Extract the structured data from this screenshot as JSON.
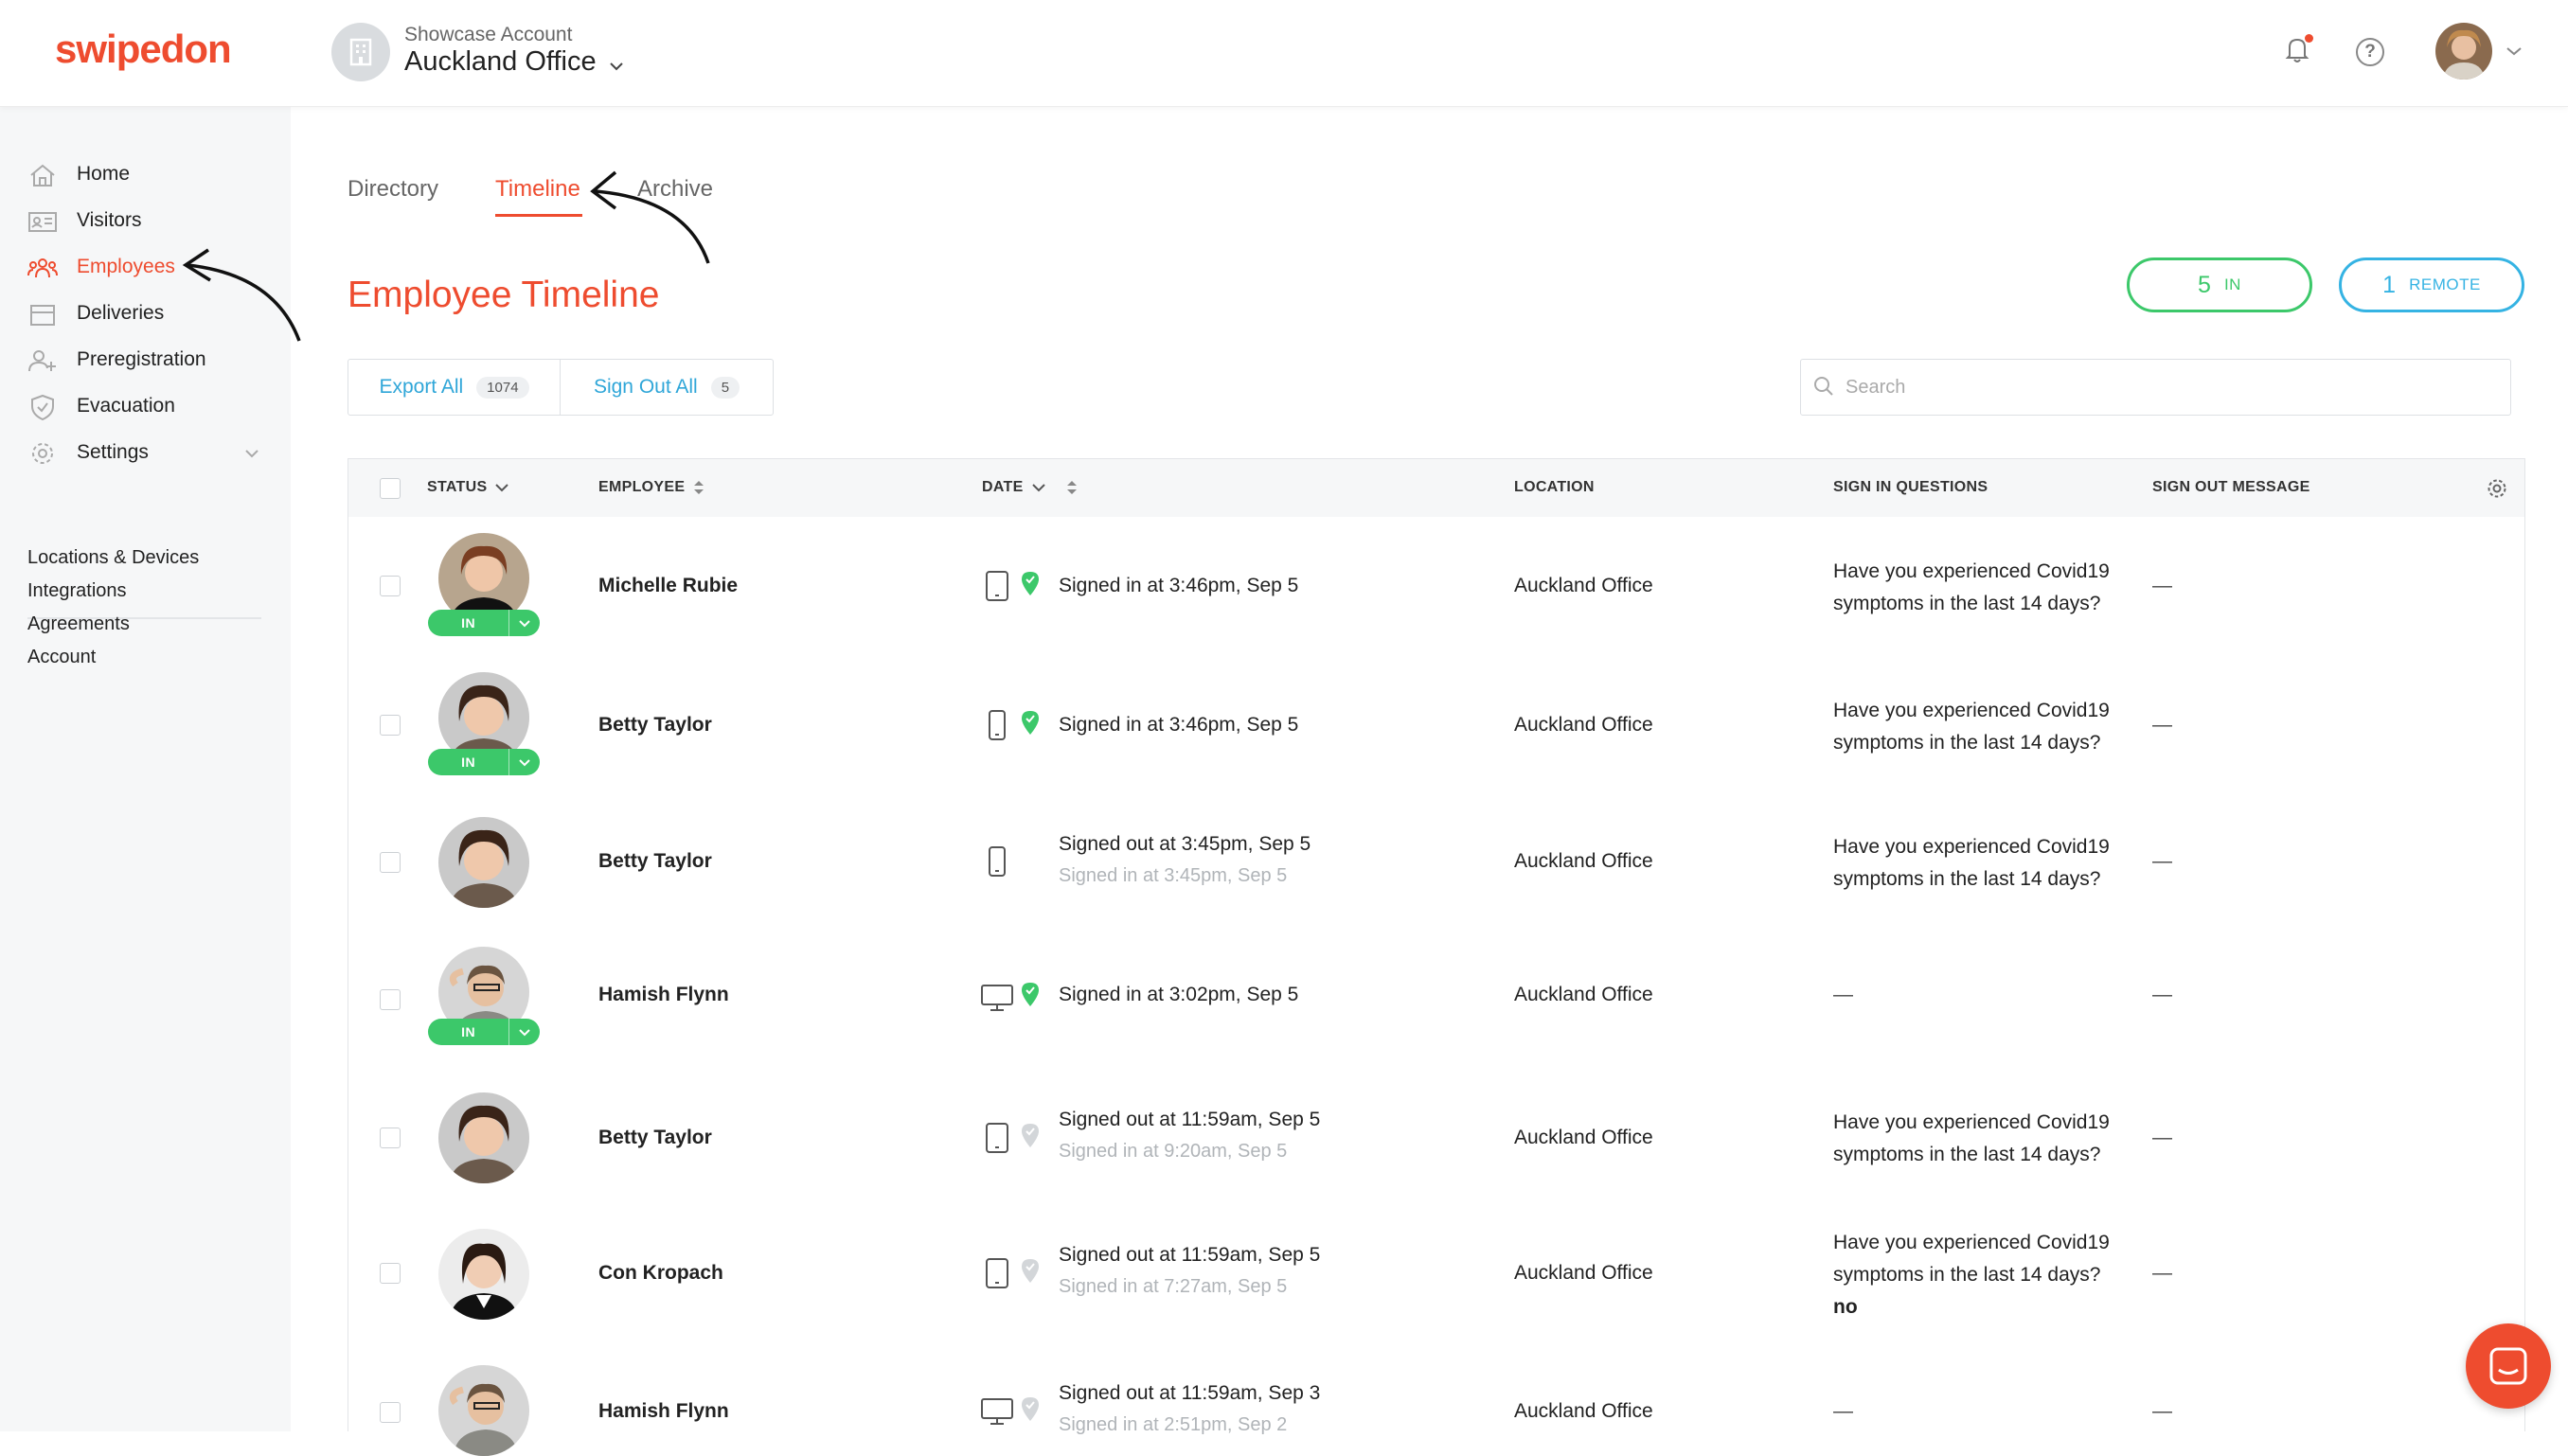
{
  "header": {
    "logo": "swipedon",
    "account_sub": "Showcase Account",
    "account_name": "Auckland Office"
  },
  "sidebar": {
    "items": [
      {
        "label": "Home",
        "icon": "home-icon"
      },
      {
        "label": "Visitors",
        "icon": "visitor-card-icon"
      },
      {
        "label": "Employees",
        "icon": "employees-icon",
        "active": true
      },
      {
        "label": "Deliveries",
        "icon": "box-icon"
      },
      {
        "label": "Preregistration",
        "icon": "add-user-icon"
      },
      {
        "label": "Evacuation",
        "icon": "shield-icon"
      },
      {
        "label": "Settings",
        "icon": "gear-icon"
      }
    ],
    "links": [
      "Locations & Devices",
      "Integrations",
      "Agreements",
      "Account"
    ]
  },
  "tabs": [
    {
      "label": "Directory"
    },
    {
      "label": "Timeline",
      "active": true
    },
    {
      "label": "Archive"
    }
  ],
  "page_title": "Employee Timeline",
  "counters": {
    "in_count": "5",
    "in_label": "IN",
    "remote_count": "1",
    "remote_label": "REMOTE"
  },
  "actions": {
    "export_label": "Export All",
    "export_count": "1074",
    "signout_label": "Sign Out All",
    "signout_count": "5"
  },
  "search": {
    "placeholder": "Search"
  },
  "table": {
    "columns": [
      "STATUS",
      "EMPLOYEE",
      "DATE",
      "LOCATION",
      "SIGN IN QUESTIONS",
      "SIGN OUT MESSAGE"
    ],
    "rows": [
      {
        "name": "Michelle Rubie",
        "status": "IN",
        "device": "tablet",
        "pin": "green",
        "line1": "Signed in at 3:46pm, Sep 5",
        "line2": "",
        "location": "Auckland Office",
        "question": "Have you experienced Covid19 symptoms in the last 14 days?",
        "answer": "",
        "signout": "—"
      },
      {
        "name": "Betty Taylor",
        "status": "IN",
        "device": "phone",
        "pin": "green",
        "line1": "Signed in at 3:46pm, Sep 5",
        "line2": "",
        "location": "Auckland Office",
        "question": "Have you experienced Covid19 symptoms in the last 14 days?",
        "answer": "",
        "signout": "—"
      },
      {
        "name": "Betty Taylor",
        "status": "",
        "device": "phone",
        "pin": "",
        "line1": "Signed out at 3:45pm, Sep 5",
        "line2": "Signed in at 3:45pm, Sep 5",
        "location": "Auckland Office",
        "question": "Have you experienced Covid19 symptoms in the last 14 days?",
        "answer": "",
        "signout": "—"
      },
      {
        "name": "Hamish Flynn",
        "status": "IN",
        "device": "desktop",
        "pin": "green",
        "line1": "Signed in at 3:02pm, Sep 5",
        "line2": "",
        "location": "Auckland Office",
        "question": "—",
        "answer": "",
        "signout": "—"
      },
      {
        "name": "Betty Taylor",
        "status": "",
        "device": "tablet",
        "pin": "grey",
        "line1": "Signed out at 11:59am, Sep 5",
        "line2": "Signed in at 9:20am, Sep 5",
        "location": "Auckland Office",
        "question": "Have you experienced Covid19 symptoms in the last 14 days?",
        "answer": "",
        "signout": "—"
      },
      {
        "name": "Con Kropach",
        "status": "",
        "device": "tablet",
        "pin": "grey",
        "line1": "Signed out at 11:59am, Sep 5",
        "line2": "Signed in at 7:27am, Sep 5",
        "location": "Auckland Office",
        "question": "Have you experienced Covid19 symptoms in the last 14 days?",
        "answer": "no",
        "signout": "—"
      },
      {
        "name": "Hamish Flynn",
        "status": "",
        "device": "desktop",
        "pin": "grey",
        "line1": "Signed out at 11:59am, Sep 3",
        "line2": "Signed in at 2:51pm, Sep 2",
        "location": "Auckland Office",
        "question": "—",
        "answer": "",
        "signout": "—"
      }
    ]
  },
  "colors": {
    "brand": "#ee4c2f",
    "in": "#3cc86a",
    "remote": "#35b3e3",
    "link": "#2fa6d8"
  }
}
